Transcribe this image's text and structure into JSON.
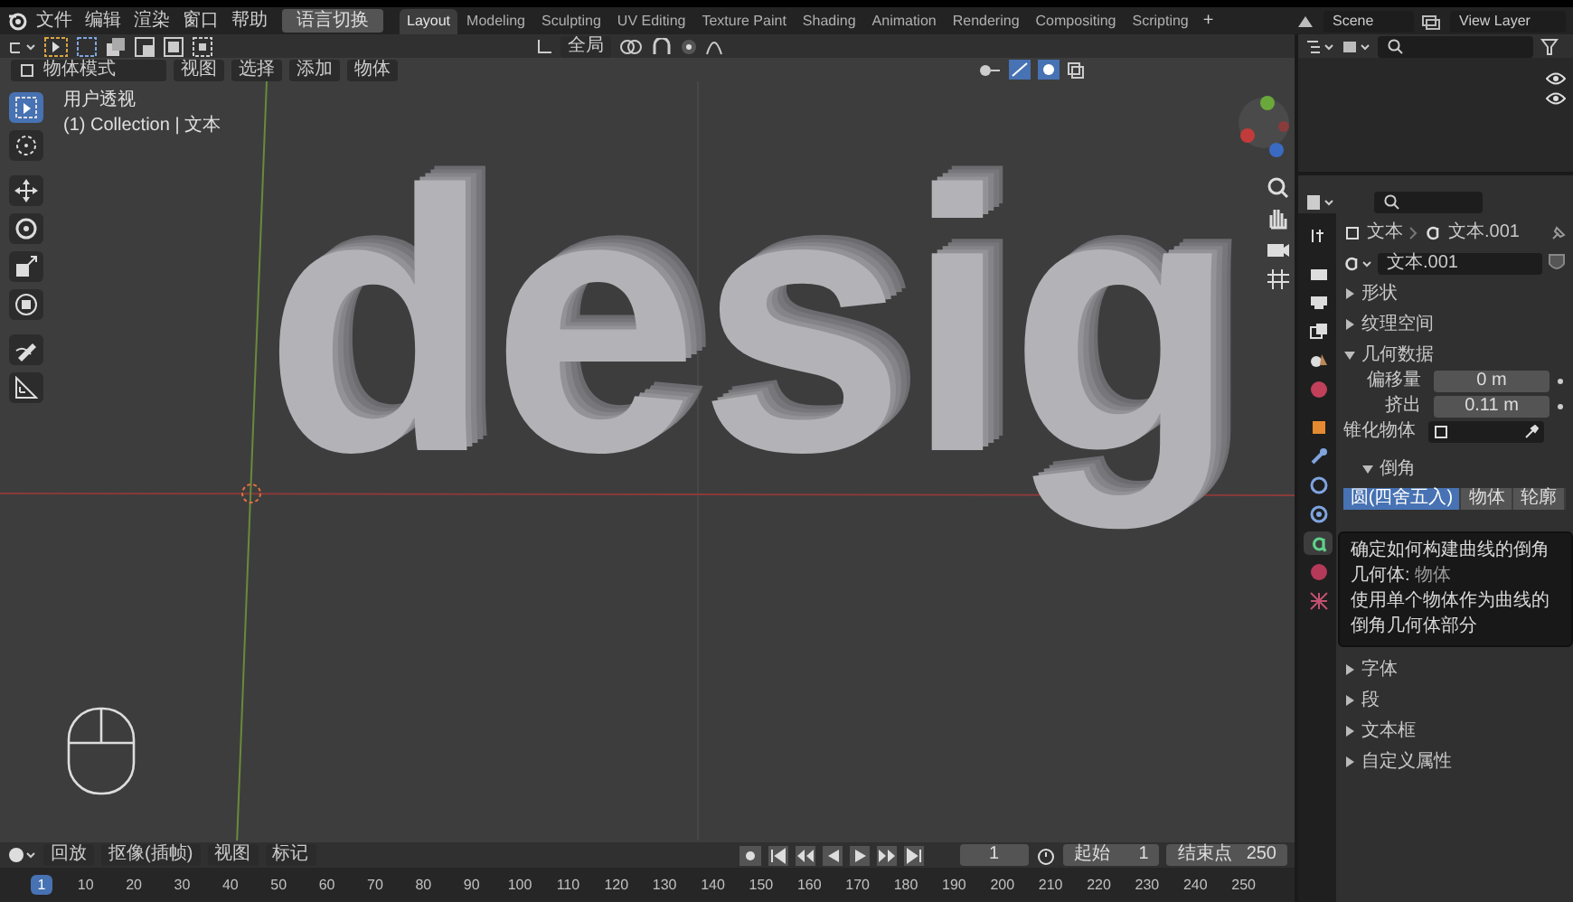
{
  "menu": [
    "文件",
    "编辑",
    "渲染",
    "窗口",
    "帮助"
  ],
  "language_button": "语言切换",
  "workspace_tabs": [
    {
      "label": "Layout",
      "selected": true
    },
    {
      "label": "Modeling",
      "selected": false
    },
    {
      "label": "Sculpting",
      "selected": false
    },
    {
      "label": "UV Editing",
      "selected": false
    },
    {
      "label": "Texture Paint",
      "selected": false
    },
    {
      "label": "Shading",
      "selected": false
    },
    {
      "label": "Animation",
      "selected": false
    },
    {
      "label": "Rendering",
      "selected": false
    },
    {
      "label": "Compositing",
      "selected": false
    },
    {
      "label": "Scripting",
      "selected": false
    }
  ],
  "add_tab": "+",
  "scene": "Scene",
  "view_layer": "View Layer",
  "tool_header": {
    "orientation": "全局"
  },
  "viewport_header": {
    "mode": "物体模式",
    "menus": [
      "视图",
      "选择",
      "添加",
      "物体"
    ]
  },
  "viewport": {
    "view_name": "用户透视",
    "collection": "(1) Collection | 文本",
    "object_text": "desig"
  },
  "toolbar": [
    {
      "kind": "select",
      "selected": true
    },
    {
      "kind": "cursor",
      "selected": false
    },
    {
      "kind": "move",
      "selected": false
    },
    {
      "kind": "rotate",
      "selected": false
    },
    {
      "kind": "scale",
      "selected": false
    },
    {
      "kind": "transform",
      "selected": false
    },
    {
      "kind": "annotate",
      "selected": false
    },
    {
      "kind": "measure",
      "selected": false
    }
  ],
  "properties": {
    "tabs": [
      {
        "kind": "tool",
        "selected": false
      },
      {
        "kind": "render",
        "selected": false
      },
      {
        "kind": "output",
        "selected": false
      },
      {
        "kind": "view_layer",
        "selected": false
      },
      {
        "kind": "scene",
        "selected": false
      },
      {
        "kind": "world",
        "selected": false
      },
      {
        "kind": "object",
        "selected": false
      },
      {
        "kind": "modifier",
        "selected": false
      },
      {
        "kind": "particles",
        "selected": false
      },
      {
        "kind": "physics",
        "selected": false
      },
      {
        "kind": "data",
        "selected": true
      },
      {
        "kind": "material",
        "selected": false
      },
      {
        "kind": "texture",
        "selected": false
      }
    ],
    "breadcrumb": [
      "文本",
      "文本.001"
    ],
    "datablock": "文本.001",
    "panels_top": [
      {
        "label": "形状",
        "expanded": false
      },
      {
        "label": "纹理空间",
        "expanded": false
      },
      {
        "label": "几何数据",
        "expanded": true
      }
    ],
    "fields": [
      {
        "label": "偏移量",
        "kind": "number",
        "value": "0 m"
      },
      {
        "label": "挤出",
        "kind": "number",
        "value": "0.11 m"
      },
      {
        "label": "锥化物体",
        "kind": "object"
      }
    ],
    "bevel": {
      "label": "倒角",
      "expanded": true,
      "modes": [
        {
          "label": "圆(四舍五入)",
          "selected": true
        },
        {
          "label": "物体",
          "selected": false
        },
        {
          "label": "轮廓",
          "selected": false
        }
      ]
    },
    "tooltip": {
      "title": "确定如何构建曲线的倒角几何体:",
      "value": "物体",
      "description": "使用单个物体作为曲线的倒角几何体部分"
    },
    "panels_bottom": [
      {
        "label": "字体",
        "expanded": false
      },
      {
        "label": "段",
        "expanded": false
      },
      {
        "label": "文本框",
        "expanded": false
      },
      {
        "label": "自定义属性",
        "expanded": false
      }
    ]
  },
  "timeline": {
    "menus": [
      "回放",
      "抠像(插帧)",
      "视图",
      "标记"
    ],
    "current_frame": "1",
    "start_label": "起始",
    "start": "1",
    "end_label": "结束点",
    "end": "250",
    "ruler": [
      {
        "label": "1",
        "selected": true
      },
      {
        "label": "10",
        "selected": false
      },
      {
        "label": "20",
        "selected": false
      },
      {
        "label": "30",
        "selected": false
      },
      {
        "label": "40",
        "selected": false
      },
      {
        "label": "50",
        "selected": false
      },
      {
        "label": "60",
        "selected": false
      },
      {
        "label": "70",
        "selected": false
      },
      {
        "label": "80",
        "selected": false
      },
      {
        "label": "90",
        "selected": false
      },
      {
        "label": "100",
        "selected": false
      },
      {
        "label": "110",
        "selected": false
      },
      {
        "label": "120",
        "selected": false
      },
      {
        "label": "130",
        "selected": false
      },
      {
        "label": "140",
        "selected": false
      },
      {
        "label": "150",
        "selected": false
      },
      {
        "label": "160",
        "selected": false
      },
      {
        "label": "170",
        "selected": false
      },
      {
        "label": "180",
        "selected": false
      },
      {
        "label": "190",
        "selected": false
      },
      {
        "label": "200",
        "selected": false
      },
      {
        "label": "210",
        "selected": false
      },
      {
        "label": "220",
        "selected": false
      },
      {
        "label": "230",
        "selected": false
      },
      {
        "label": "240",
        "selected": false
      },
      {
        "label": "250",
        "selected": false
      }
    ]
  }
}
